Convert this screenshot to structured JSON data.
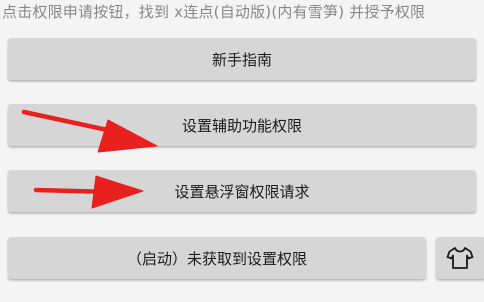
{
  "instruction_text": "点击权限申请按钮，找到 x连点(自动版)(内有雪笋) 并授予权限",
  "buttons": {
    "guide_label": "新手指南",
    "accessibility_label": "设置辅助功能权限",
    "overlay_label": "设置悬浮窗权限请求",
    "start_label": "（启动）未获取到设置权限"
  },
  "shirt_icon": "shirt-icon",
  "colors": {
    "background": "#f4f4f4",
    "button": "#d6d6d6",
    "text": "#1b1b1b",
    "instruction": "#888888",
    "annotation_arrow": "#e8201e"
  }
}
